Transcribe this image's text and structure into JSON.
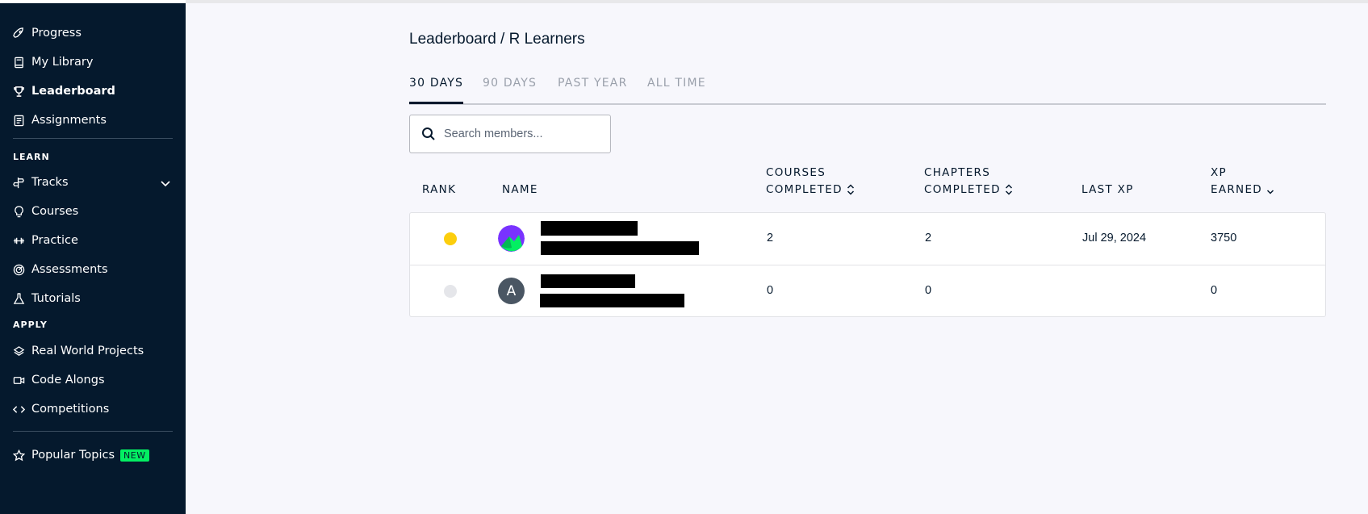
{
  "sidebar": {
    "items": [
      {
        "label": "Progress",
        "icon": "rocket-icon"
      },
      {
        "label": "My Library",
        "icon": "book-icon"
      },
      {
        "label": "Leaderboard",
        "icon": "trophy-icon",
        "active": true
      },
      {
        "label": "Assignments",
        "icon": "clipboard-icon"
      }
    ],
    "learn_label": "LEARN",
    "learn_items": [
      {
        "label": "Tracks",
        "icon": "tracks-icon"
      },
      {
        "label": "Courses",
        "icon": "lightbulb-icon"
      },
      {
        "label": "Practice",
        "icon": "dumbbell-icon"
      },
      {
        "label": "Assessments",
        "icon": "gauge-icon"
      },
      {
        "label": "Tutorials",
        "icon": "flask-icon"
      }
    ],
    "apply_label": "APPLY",
    "apply_items": [
      {
        "label": "Real World Projects",
        "icon": "layers-icon"
      },
      {
        "label": "Code Alongs",
        "icon": "video-icon"
      },
      {
        "label": "Competitions",
        "icon": "code-icon"
      }
    ],
    "popular": {
      "label": "Popular Topics",
      "badge": "NEW",
      "icon": "star-icon"
    }
  },
  "breadcrumb": "Leaderboard / R Learners",
  "tabs": [
    {
      "label": "30 DAYS",
      "active": true
    },
    {
      "label": "90 DAYS"
    },
    {
      "label": "PAST YEAR"
    },
    {
      "label": "ALL TIME"
    }
  ],
  "search": {
    "placeholder": "Search members..."
  },
  "table": {
    "headers": {
      "rank": "RANK",
      "name": "NAME",
      "courses_1": "COURSES",
      "courses_2": "COMPLETED",
      "chapters_1": "CHAPTERS",
      "chapters_2": "COMPLETED",
      "last_xp": "LAST XP",
      "xp_1": "XP",
      "xp_2": "EARNED"
    },
    "rows": [
      {
        "rank_color": "#fcce0d",
        "avatar_initial": "",
        "courses": "2",
        "chapters": "2",
        "last_xp": "Jul 29, 2024",
        "xp": "3750"
      },
      {
        "rank_color": "#e5e6ea",
        "avatar_initial": "A",
        "courses": "0",
        "chapters": "0",
        "last_xp": "",
        "xp": "0"
      }
    ]
  },
  "colors": {
    "sidebar_bg": "#05192d",
    "accent_green": "#03ef62",
    "gold": "#fcce0d"
  }
}
